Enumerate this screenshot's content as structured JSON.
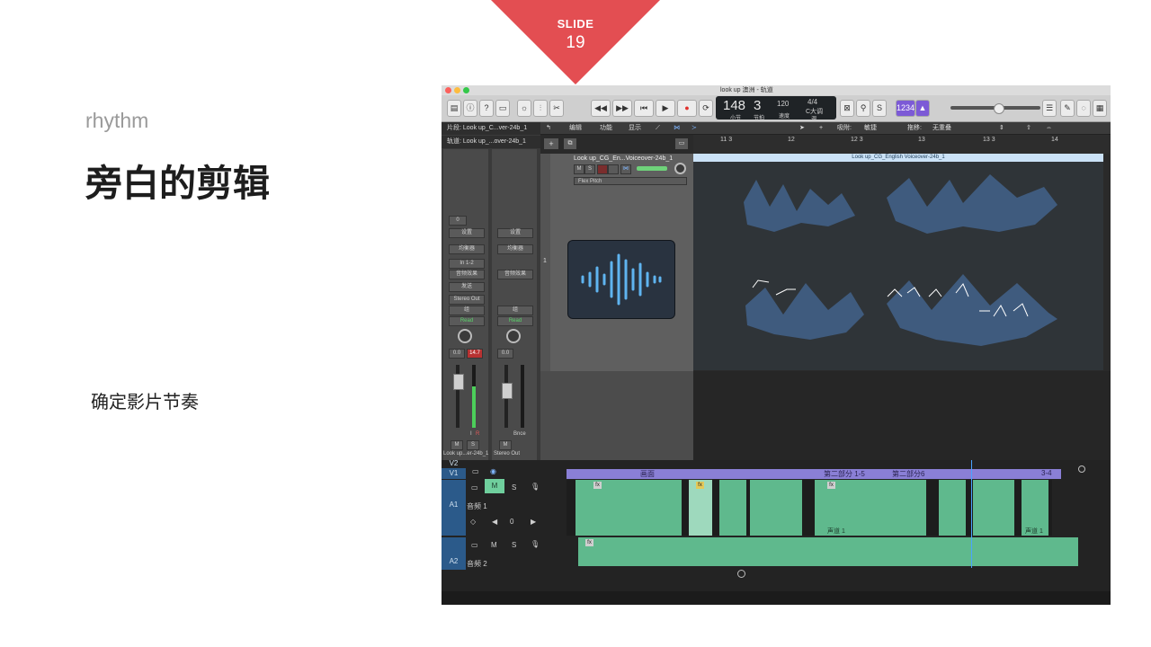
{
  "slide": {
    "label": "SLIDE",
    "number": "19",
    "kicker": "rhythm",
    "title": "旁白的剪辑",
    "body": "确定影片节奏",
    "accent_color": "#e34e52"
  },
  "app": {
    "window_title": "look up 澳洲 - 轨道",
    "lcd": {
      "bar": "148",
      "beat": "3",
      "bar_label": "小节",
      "beat_label": "节拍",
      "tempo": "120",
      "tempo_label": "速度",
      "time_sig": "4/4",
      "key": "C大调",
      "key_label": "调"
    },
    "inspector": {
      "region_row": "片段: Look up_C...ver-24b_1",
      "track_row": "轨道: Look up_...over-24b_1",
      "value_box": "0",
      "setting": "设置",
      "eq": "均衡器",
      "input": "In 1-2",
      "audio_fx": "音频效果",
      "send": "发送",
      "output_left": "Stereo Out",
      "group": "组",
      "automation": "Read",
      "vol_left": "0.0",
      "vol_peak": "14.7",
      "vol_right": "0.0",
      "mute": "M",
      "solo": "S",
      "input_ind": "I",
      "record_ind": "R",
      "bounce": "Bnce",
      "footer_left": "Look up...er-24b_1",
      "footer_right": "Stereo Out"
    },
    "tracks_menu": {
      "edit": "编辑",
      "functions": "功能",
      "view": "显示",
      "snap_label": "吸附:",
      "snap_value": "敏捷",
      "drag_label": "拖移:",
      "drag_value": "无重叠"
    },
    "ruler": [
      "11 3",
      "12",
      "12 3",
      "13",
      "13 3",
      "14"
    ],
    "track": {
      "number": "1",
      "name": "Look up_CG_En...Voiceover-24b_1",
      "mute": "M",
      "solo": "S",
      "flex": "Flex Pitch"
    },
    "region_name": "Look up_CG_English Voiceover-24b_1"
  },
  "timeline": {
    "v2": "V2",
    "v1": "V1",
    "a1": "A1",
    "a2": "A2",
    "mute": "M",
    "solo": "S",
    "a1_name": "音频 1",
    "a2_name": "音频 2",
    "a1_value": "0",
    "video_labels": [
      "画面",
      "第二部分 1-5",
      "第二部分6",
      "3-4"
    ],
    "fx": "fx",
    "clip_label": "声道 1"
  }
}
